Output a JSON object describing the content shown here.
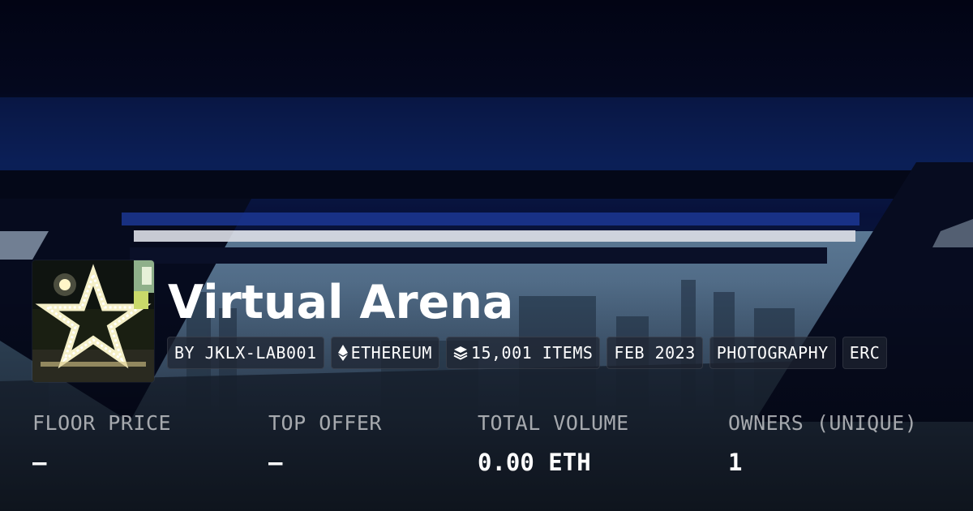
{
  "collection": {
    "name": "Virtual Arena"
  },
  "chips": [
    {
      "label": "BY JKLX-LAB001",
      "icon": ""
    },
    {
      "label": "ETHEREUM",
      "icon": "ethereum-icon"
    },
    {
      "label": "15,001 ITEMS",
      "icon": "layers-icon"
    },
    {
      "label": "FEB 2023",
      "icon": ""
    },
    {
      "label": "PHOTOGRAPHY",
      "icon": ""
    },
    {
      "label": "ERC",
      "icon": ""
    }
  ],
  "stats": [
    {
      "label": "FLOOR PRICE",
      "value": "—"
    },
    {
      "label": "TOP OFFER",
      "value": "—"
    },
    {
      "label": "TOTAL VOLUME",
      "value": "0.00 ETH"
    },
    {
      "label": "OWNERS (UNIQUE)",
      "value": "1"
    }
  ],
  "colors": {
    "background": "#05081a",
    "text": "#ffffff",
    "muted_text": "#9ea3ad",
    "chip_background": "#1e2430"
  }
}
